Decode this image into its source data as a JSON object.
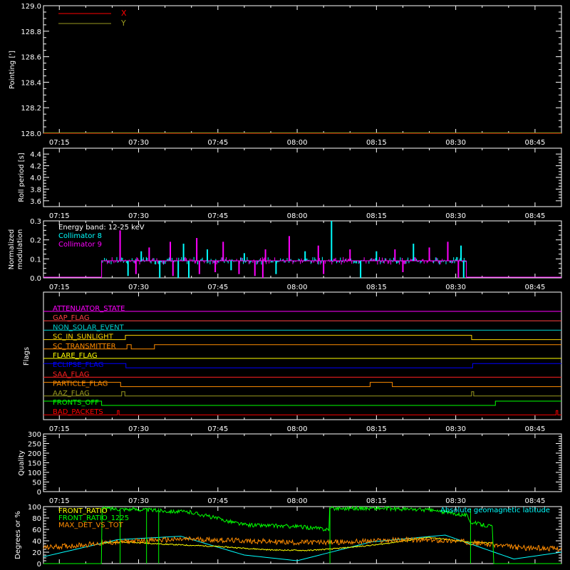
{
  "colors": {
    "axes": "#ffffff",
    "x_series": "#ff0000",
    "y_series": "#9a9a1f",
    "collimator_8": "#00ffff",
    "collimator_9": "#ff00ff",
    "front_ratio": "#ffff00",
    "front_ratio_1225": "#00ff00",
    "max_det_vs_tot": "#ff8c00",
    "geomag": "#00ffff"
  },
  "time_axis": {
    "ticks": [
      "07:15",
      "07:30",
      "07:45",
      "08:00",
      "08:15",
      "08:30",
      "08:45"
    ],
    "tick_minutes": [
      435,
      450,
      465,
      480,
      495,
      510,
      525
    ],
    "range_minutes": [
      432,
      530
    ]
  },
  "chart_data": [
    {
      "type": "line",
      "ylabel": "Pointing [']",
      "ylim": [
        128.0,
        129.0
      ],
      "yticks": [
        "128.0",
        "128.2",
        "128.4",
        "128.6",
        "128.8",
        "129.0"
      ],
      "yvalues": [
        128.0,
        128.2,
        128.4,
        128.6,
        128.8,
        129.0
      ],
      "legend_position": "top-left",
      "series": [
        {
          "name": "X",
          "x": [
            432,
            530
          ],
          "values": [
            128.0,
            128.0
          ]
        },
        {
          "name": "Y",
          "x": [
            432,
            530
          ],
          "values": [
            128.0,
            128.0
          ]
        }
      ]
    },
    {
      "type": "line",
      "ylabel": "Roll period [s]",
      "ylim": [
        3.5,
        4.5
      ],
      "yticks": [
        "3.6",
        "3.8",
        "4.0",
        "4.2",
        "4.4"
      ],
      "yvalues": [
        3.6,
        3.8,
        4.0,
        4.2,
        4.4
      ],
      "series": []
    },
    {
      "type": "bar",
      "ylabel": "Normalized modulation",
      "ylim": [
        0,
        0.3
      ],
      "yticks": [
        "0.0",
        "0.1",
        "0.2",
        "0.3"
      ],
      "yvalues": [
        0.0,
        0.1,
        0.2,
        0.3
      ],
      "annotation": "Energy band: 12-25 keV",
      "legend_position": "top-left",
      "active_range_minutes": [
        443,
        512
      ],
      "baseline": 0.09,
      "series": [
        {
          "name": "Collimator 8"
        },
        {
          "name": "Collimator 9"
        }
      ],
      "spikes_up": [
        {
          "series": 1,
          "x": 446.5,
          "y": 0.25
        },
        {
          "series": 0,
          "x": 450.5,
          "y": 0.14
        },
        {
          "series": 1,
          "x": 452.0,
          "y": 0.16
        },
        {
          "series": 1,
          "x": 456.0,
          "y": 0.19
        },
        {
          "series": 0,
          "x": 458.5,
          "y": 0.18
        },
        {
          "series": 1,
          "x": 461.0,
          "y": 0.21
        },
        {
          "series": 0,
          "x": 463.0,
          "y": 0.15
        },
        {
          "series": 1,
          "x": 466.0,
          "y": 0.19
        },
        {
          "series": 0,
          "x": 470.0,
          "y": 0.13
        },
        {
          "series": 1,
          "x": 474.0,
          "y": 0.15
        },
        {
          "series": 1,
          "x": 478.5,
          "y": 0.22
        },
        {
          "series": 0,
          "x": 481.5,
          "y": 0.14
        },
        {
          "series": 1,
          "x": 484.0,
          "y": 0.17
        },
        {
          "series": 0,
          "x": 486.5,
          "y": 0.3
        },
        {
          "series": 1,
          "x": 490.0,
          "y": 0.15
        },
        {
          "series": 0,
          "x": 495.0,
          "y": 0.14
        },
        {
          "series": 1,
          "x": 498.5,
          "y": 0.15
        },
        {
          "series": 0,
          "x": 502.0,
          "y": 0.18
        },
        {
          "series": 1,
          "x": 505.0,
          "y": 0.16
        },
        {
          "series": 1,
          "x": 508.5,
          "y": 0.19
        },
        {
          "series": 0,
          "x": 511.0,
          "y": 0.17
        }
      ],
      "spikes_down": [
        {
          "series": 0,
          "x": 448.0,
          "y": 0.01
        },
        {
          "series": 1,
          "x": 449.5,
          "y": 0.02
        },
        {
          "series": 0,
          "x": 454.0,
          "y": 0.0
        },
        {
          "series": 1,
          "x": 456.5,
          "y": 0.01
        },
        {
          "series": 0,
          "x": 457.5,
          "y": 0.0
        },
        {
          "series": 0,
          "x": 459.5,
          "y": 0.0
        },
        {
          "series": 1,
          "x": 461.5,
          "y": 0.02
        },
        {
          "series": 1,
          "x": 464.5,
          "y": 0.03
        },
        {
          "series": 0,
          "x": 467.5,
          "y": 0.04
        },
        {
          "series": 1,
          "x": 469.0,
          "y": 0.02
        },
        {
          "series": 1,
          "x": 472.0,
          "y": 0.01
        },
        {
          "series": 1,
          "x": 473.5,
          "y": 0.0
        },
        {
          "series": 0,
          "x": 476.0,
          "y": 0.02
        },
        {
          "series": 1,
          "x": 485.0,
          "y": 0.02
        },
        {
          "series": 0,
          "x": 492.0,
          "y": 0.0
        },
        {
          "series": 1,
          "x": 500.0,
          "y": 0.03
        },
        {
          "series": 1,
          "x": 510.5,
          "y": 0.0
        },
        {
          "series": 0,
          "x": 511.5,
          "y": 0.0
        }
      ]
    },
    {
      "type": "line",
      "ylabel": "Flags",
      "flags": [
        {
          "name": "ATTENUATOR_STATE",
          "color": "#ff00ff",
          "high": []
        },
        {
          "name": "GAP_FLAG",
          "color": "#ff4040",
          "high": []
        },
        {
          "name": "NON_SOLAR_EVENT",
          "color": "#00d0d0",
          "high": []
        },
        {
          "name": "SC_IN_SUNLIGHT",
          "color": "#ffd700",
          "high": [
            [
              447.5,
              513.0
            ]
          ]
        },
        {
          "name": "SC_TRANSMITTER",
          "color": "#ff8c00",
          "high": [
            [
              447.8,
              448.6
            ],
            [
              453.0,
              530.0
            ]
          ]
        },
        {
          "name": "FLARE_FLAG",
          "color": "#ffff00",
          "high": []
        },
        {
          "name": "ECLIPSE_FLAG",
          "color": "#0000ff",
          "high": [
            [
              432.0,
              447.6
            ],
            [
              513.2,
              530.0
            ]
          ]
        },
        {
          "name": "SAA_FLAG",
          "color": "#ff2020",
          "high": []
        },
        {
          "name": "PARTICLE_FLAG",
          "color": "#ff8c00",
          "high": [
            [
              432.0,
              446.6
            ],
            [
              493.8,
              498.0
            ]
          ]
        },
        {
          "name": "AAZ_FLAG",
          "color": "#9a9a1f",
          "high": [
            [
              446.8,
              447.4
            ],
            [
              513.0,
              513.4
            ]
          ]
        },
        {
          "name": "FRONTS_OFF",
          "color": "#00ff00",
          "high": [
            [
              432.0,
              443.0
            ],
            [
              517.5,
              530.0
            ]
          ]
        },
        {
          "name": "BAD_PACKETS",
          "color": "#ff0000",
          "high": [
            [
              446.0,
              446.3
            ],
            [
              529.0,
              529.3
            ]
          ]
        }
      ]
    },
    {
      "type": "line",
      "ylabel": "Quality",
      "ylim": [
        0,
        300
      ],
      "yticks": [
        "0",
        "50",
        "100",
        "150",
        "200",
        "250",
        "300"
      ],
      "yvalues": [
        0,
        50,
        100,
        150,
        200,
        250,
        300
      ],
      "series": []
    },
    {
      "type": "line",
      "ylabel": "Degrees or %",
      "ylim": [
        0,
        100
      ],
      "yticks": [
        "0",
        "20",
        "40",
        "60",
        "80",
        "100"
      ],
      "yvalues": [
        0,
        20,
        40,
        60,
        80,
        100
      ],
      "legend_position": "top-left",
      "annotation": "Absolute geomagnetic latitude",
      "series": [
        {
          "name": "FRONT_RATIO",
          "x": [
            443,
            447,
            455,
            465,
            475,
            482,
            487,
            495,
            505,
            512,
            517
          ],
          "values": [
            36,
            38,
            34,
            30,
            24,
            23,
            26,
            33,
            46,
            38,
            36
          ]
        },
        {
          "name": "FRONT_RATIO_1225",
          "x": [
            432,
            443,
            443.1,
            450,
            460,
            470,
            480,
            486,
            486.1,
            495,
            505,
            512,
            513,
            517,
            517.1,
            530
          ],
          "values": [
            0,
            0,
            97,
            95,
            90,
            68,
            65,
            60,
            97,
            97,
            94,
            85,
            72,
            65,
            0,
            0
          ]
        },
        {
          "name": "MAX_DET_VS_TOT",
          "x": [
            432,
            435,
            440,
            443,
            450,
            460,
            470,
            480,
            490,
            500,
            510,
            517,
            522,
            530
          ],
          "values": [
            28,
            30,
            33,
            36,
            40,
            43,
            40,
            37,
            38,
            42,
            40,
            33,
            28,
            26
          ]
        },
        {
          "name": "Absolute geomagnetic latitude",
          "x": [
            432,
            446,
            458,
            470,
            480,
            494,
            508,
            521,
            530
          ],
          "values": [
            12,
            42,
            48,
            15,
            5,
            38,
            50,
            8,
            20
          ]
        }
      ]
    }
  ]
}
